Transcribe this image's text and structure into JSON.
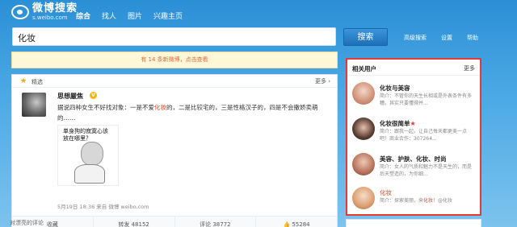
{
  "logo": {
    "title": "微博搜索",
    "subtitle": "s.weibo.com"
  },
  "topnav": {
    "items": [
      "综合",
      "找人",
      "图片",
      "兴趣主页"
    ]
  },
  "search": {
    "query": "化妆",
    "button": "搜索",
    "links": [
      "高级搜索",
      "设置",
      "帮助"
    ]
  },
  "notice": "有 14 条新微博，点击查看",
  "feed": {
    "section_label": "精选",
    "more": "更多 ›",
    "post": {
      "author": "思想嚴焦",
      "badge": "V",
      "text_before": "据说四种女生不好找对象：一是不爱",
      "text_highlight": "化妆",
      "text_after": "的，二是比较宅的，三是性格汉子的，四是不会撒娇卖萌的……",
      "image_caption": "单身狗的寂寞心该放在哪里？",
      "meta": "5月19日 18:36 来自 微博 weibo.com"
    },
    "actions": {
      "fav": "收藏",
      "repost": "转发 48152",
      "comment": "评论 38772",
      "like": "55284"
    },
    "subhead": "对漂亮的评论"
  },
  "sidebar": {
    "title": "相关用户",
    "more": "更多",
    "users": [
      {
        "name": "化妆与美容",
        "desc": "简介：不管你的天生长相或是外表条件有多糟，其实只要懂得并...",
        "avatar_color": "#e9b9a4"
      },
      {
        "name": "化妆很简单",
        "desc": "简介：跟我一起，让自己每天都更美一点吧！商业合作：307264...",
        "avatar_color": "#4a3a35",
        "star": "★"
      },
      {
        "name": "美容、护肤、化妆、时尚",
        "desc": "简介：女人的气质和魅力不是天生的，而是后天塑造的，为你细...",
        "avatar_color": "#d79a86"
      },
      {
        "name": "化妆",
        "desc_before": "简介：探索美丽，来",
        "desc_highlight": "化妆",
        "desc_after": "！@化妆",
        "avatar_color": "#e7b48a"
      }
    ]
  }
}
